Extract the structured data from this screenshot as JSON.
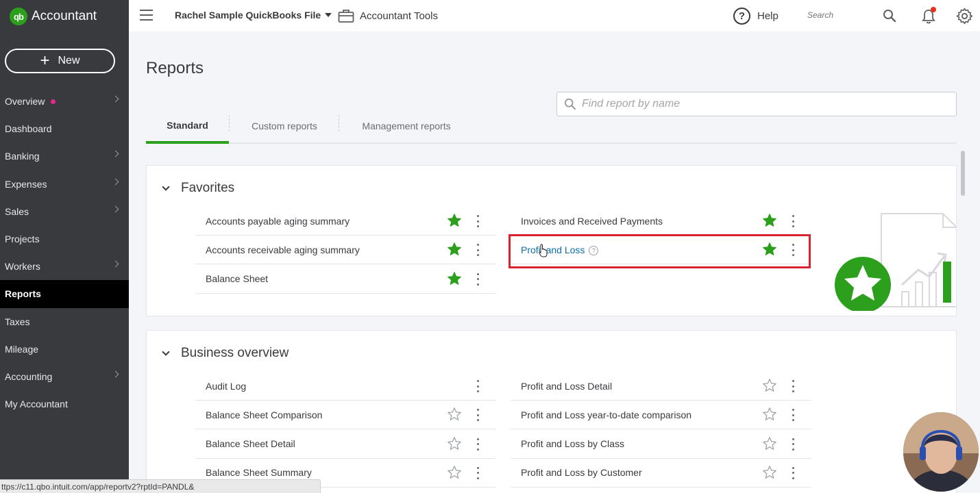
{
  "brand": {
    "logo_text": "qb",
    "name": "Accountant"
  },
  "new_button": {
    "label": "New"
  },
  "sidebar": {
    "items": [
      {
        "label": "Overview",
        "has_chevron": true,
        "has_dot": true
      },
      {
        "label": "Dashboard",
        "has_chevron": false
      },
      {
        "label": "Banking",
        "has_chevron": true
      },
      {
        "label": "Expenses",
        "has_chevron": true
      },
      {
        "label": "Sales",
        "has_chevron": true
      },
      {
        "label": "Projects",
        "has_chevron": false
      },
      {
        "label": "Workers",
        "has_chevron": true
      },
      {
        "label": "Reports",
        "has_chevron": false,
        "active": true
      },
      {
        "label": "Taxes",
        "has_chevron": false
      },
      {
        "label": "Mileage",
        "has_chevron": false
      },
      {
        "label": "Accounting",
        "has_chevron": true
      },
      {
        "label": "My Accountant",
        "has_chevron": false
      }
    ]
  },
  "topbar": {
    "company": "Rachel Sample QuickBooks File",
    "accountant_tools": "Accountant Tools",
    "help": "Help",
    "search_placeholder": "Search"
  },
  "page": {
    "title": "Reports",
    "tabs": [
      {
        "label": "Standard",
        "active": true
      },
      {
        "label": "Custom reports"
      },
      {
        "label": "Management reports"
      }
    ],
    "find_placeholder": "Find report by name"
  },
  "favorites": {
    "title": "Favorites",
    "left": [
      {
        "label": "Accounts payable aging summary",
        "favorite": true
      },
      {
        "label": "Accounts receivable aging summary",
        "favorite": true
      },
      {
        "label": "Balance Sheet",
        "favorite": true
      }
    ],
    "right": [
      {
        "label": "Invoices and Received Payments",
        "favorite": true
      },
      {
        "label": "Profit and Loss",
        "favorite": true,
        "link": true,
        "info": true
      }
    ]
  },
  "business_overview": {
    "title": "Business overview",
    "left": [
      {
        "label": "Audit Log",
        "favorite": false,
        "no_star": true
      },
      {
        "label": "Balance Sheet Comparison",
        "favorite": false
      },
      {
        "label": "Balance Sheet Detail",
        "favorite": false
      },
      {
        "label": "Balance Sheet Summary",
        "favorite": false
      }
    ],
    "right": [
      {
        "label": "Profit and Loss Detail",
        "favorite": false
      },
      {
        "label": "Profit and Loss year-to-date comparison",
        "favorite": false
      },
      {
        "label": "Profit and Loss by Class",
        "favorite": false
      },
      {
        "label": "Profit and Loss by Customer",
        "favorite": false
      }
    ]
  },
  "status_bar": {
    "url": "ttps://c11.qbo.intuit.com/app/reportv2?rptId=PANDL&"
  },
  "colors": {
    "brand_green": "#2ca01c",
    "sidebar_bg": "#393a3d",
    "highlight_red": "#d9232e",
    "link_blue": "#0d6eaa"
  }
}
